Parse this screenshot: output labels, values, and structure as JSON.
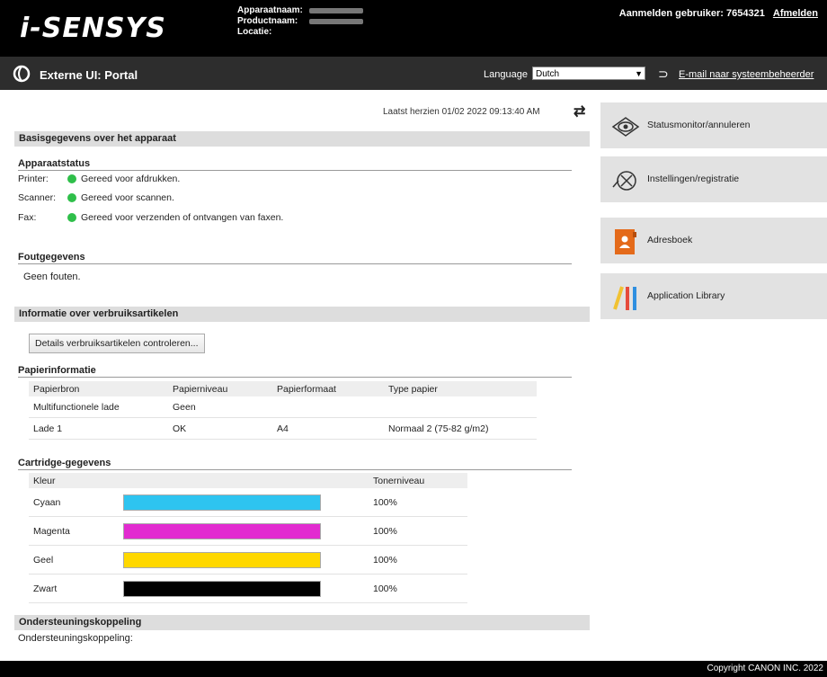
{
  "header": {
    "logo": "i-SENSYS",
    "device_labels": [
      "Apparaatnaam:",
      "Productnaam:",
      "Locatie:"
    ],
    "login_label": "Aanmelden gebruiker:",
    "user_id": "7654321",
    "logout": "Afmelden"
  },
  "nav": {
    "title": "Externe UI: Portal",
    "language_label": "Language",
    "language_value": "Dutch",
    "mail_link": "E-mail naar systeembeheerder"
  },
  "main": {
    "updated": "Laatst herzien 01/02 2022 09:13:40 AM",
    "sections": {
      "basic": "Basisgegevens over het apparaat",
      "consumables": "Informatie over verbruiksartikelen",
      "support": "Ondersteuningskoppeling"
    },
    "device_status_heading": "Apparaatstatus",
    "status": [
      {
        "label": "Printer:",
        "text": "Gereed voor afdrukken."
      },
      {
        "label": "Scanner:",
        "text": "Gereed voor scannen."
      },
      {
        "label": "Fax:",
        "text": "Gereed voor verzenden of ontvangen van faxen."
      }
    ],
    "error_heading": "Foutgegevens",
    "error_text": "Geen fouten.",
    "check_button": "Details verbruiksartikelen controleren...",
    "paper_heading": "Papierinformatie",
    "paper_columns": [
      "Papierbron",
      "Papierniveau",
      "Papierformaat",
      "Type papier"
    ],
    "paper_rows": [
      [
        "Multifunctionele lade",
        "Geen",
        "",
        ""
      ],
      [
        "Lade 1",
        "OK",
        "A4",
        "Normaal 2 (75-82 g/m2)"
      ]
    ],
    "cartridge_heading": "Cartridge-gegevens",
    "cartridge_columns": [
      "Kleur",
      "",
      "Tonerniveau"
    ],
    "cartridges": [
      {
        "name": "Cyaan",
        "level": "100%",
        "color": "#2ec4f0"
      },
      {
        "name": "Magenta",
        "level": "100%",
        "color": "#e22bd0"
      },
      {
        "name": "Geel",
        "level": "100%",
        "color": "#ffd800"
      },
      {
        "name": "Zwart",
        "level": "100%",
        "color": "#000000"
      }
    ],
    "support_label": "Ondersteuningskoppeling:"
  },
  "sidebar": {
    "tiles": [
      {
        "label": "Statusmonitor/annuleren",
        "icon": "eye-icon"
      },
      {
        "label": "Instellingen/registratie",
        "icon": "settings-icon"
      },
      {
        "label": "Adresboek",
        "icon": "address-book-icon"
      },
      {
        "label": "Application Library",
        "icon": "library-icon"
      }
    ]
  },
  "footer": {
    "copyright": "Copyright CANON INC. 2022"
  }
}
